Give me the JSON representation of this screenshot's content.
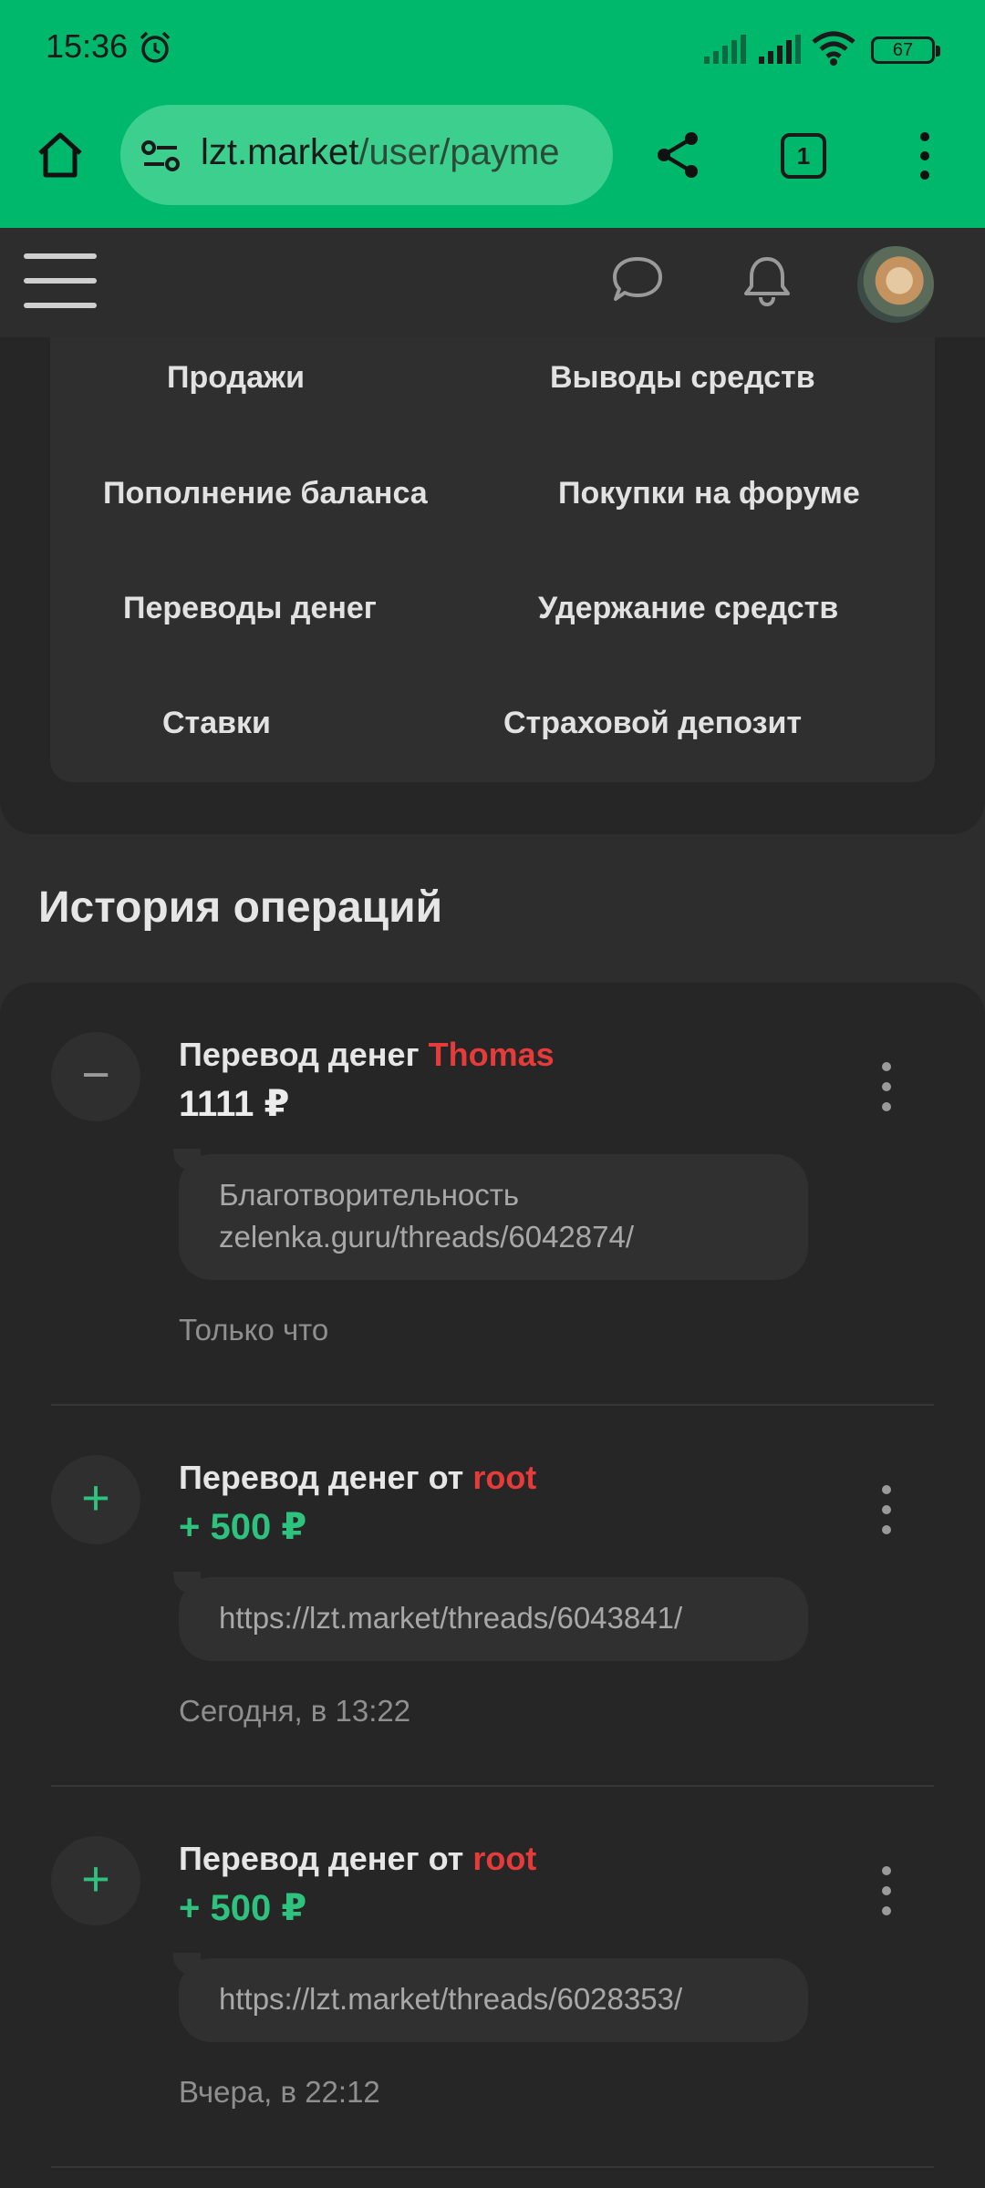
{
  "status_bar": {
    "time": "15:36",
    "battery": "67"
  },
  "browser": {
    "url_host": "lzt.market",
    "url_path": "/user/payme",
    "tab_count": "1"
  },
  "menu": {
    "items": [
      "Продажи",
      "Выводы средств",
      "Пополнение баланса",
      "Покупки на форуме",
      "Переводы денег",
      "Удержание средств",
      "Ставки",
      "Страховой депозит"
    ]
  },
  "history": {
    "title": "История операций",
    "operations": [
      {
        "type": "minus",
        "sign": "−",
        "title": "Перевод денег",
        "user": "Thomas",
        "amount": "1111 ₽",
        "comment_line1": "Благотворительность",
        "comment_line2": "zelenka.guru/threads/6042874/",
        "time": "Только что"
      },
      {
        "type": "plus",
        "sign": "+",
        "title": "Перевод денег от",
        "user": "root",
        "amount": "+ 500 ₽",
        "comment_line1": "https://lzt.market/threads/6043841/",
        "time": "Сегодня, в 13:22"
      },
      {
        "type": "plus",
        "sign": "+",
        "title": "Перевод денег от",
        "user": "root",
        "amount": "+ 500 ₽",
        "comment_line1": "https://lzt.market/threads/6028353/",
        "time": "Вчера, в 22:12"
      }
    ]
  },
  "colors": {
    "chrome_green": "#00b86b",
    "user_red": "#e53b3b",
    "positive_green": "#2ec27e"
  }
}
